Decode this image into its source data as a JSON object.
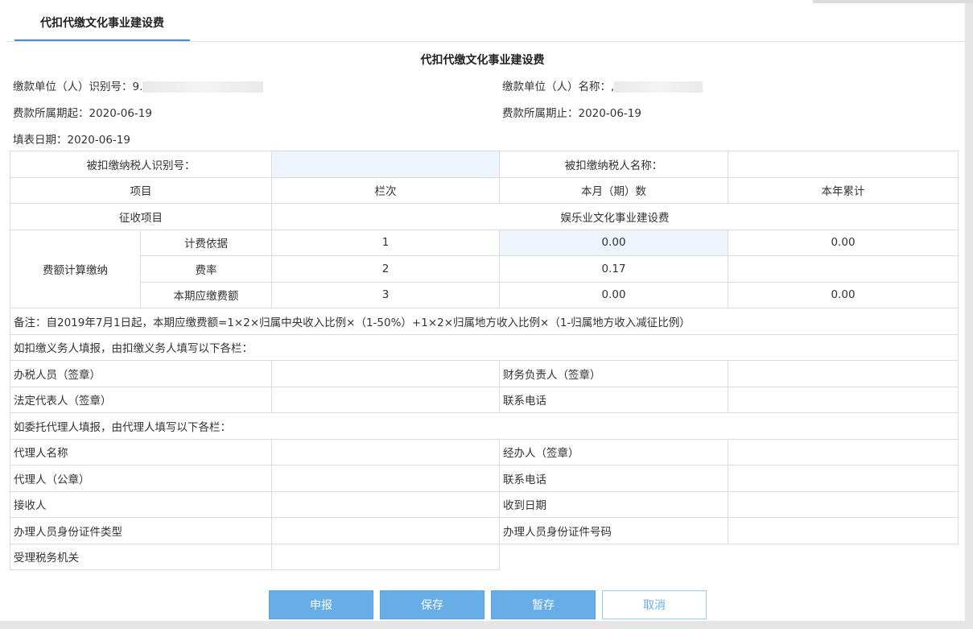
{
  "tab": {
    "label": "代扣代缴文化事业建设费"
  },
  "form_title": "代扣代缴文化事业建设费",
  "header": {
    "payer_id_label": "缴款单位（人）识别号：",
    "payer_id_value": "9.",
    "payer_name_label": "缴款单位（人）名称：",
    "payer_name_value": ",",
    "period_start_label": "费款所属期起：",
    "period_start_value": "2020-06-19",
    "period_end_label": "费款所属期止：",
    "period_end_value": "2020-06-19",
    "fill_date_label": "填表日期：",
    "fill_date_value": "2020-06-19"
  },
  "table": {
    "withheld_id_label": "被扣缴纳税人识别号：",
    "withheld_name_label": "被扣缴纳税人名称：",
    "col_item": "项目",
    "col_line": "栏次",
    "col_month": "本月（期）数",
    "col_year": "本年累计",
    "levy_item_label": "征收项目",
    "levy_item_value": "娱乐业文化事业建设费",
    "calc_group_label": "费额计算缴纳",
    "rows": [
      {
        "label": "计费依据",
        "line": "1",
        "month": "0.00",
        "year": "0.00"
      },
      {
        "label": "费率",
        "line": "2",
        "month": "0.17",
        "year": ""
      },
      {
        "label": "本期应缴费额",
        "line": "3",
        "month": "0.00",
        "year": "0.00"
      }
    ],
    "note": "备注：自2019年7月1日起，本期应缴费额=1×2×归属中央收入比例×（1-50%）+1×2×归属地方收入比例×（1-归属地方收入减征比例）",
    "withholder_section": "如扣缴义务人填报，由扣缴义务人填写以下各栏：",
    "tax_officer_label": "办税人员（签章）",
    "finance_head_label": "财务负责人（签章）",
    "legal_rep_label": "法定代表人（签章）",
    "phone_label_1": "联系电话",
    "agent_section": "如委托代理人填报，由代理人填写以下各栏：",
    "agent_name_label": "代理人名称",
    "handler_label": "经办人（签章）",
    "agent_seal_label": "代理人（公章）",
    "phone_label_2": "联系电话",
    "receiver_label": "接收人",
    "receive_date_label": "收到日期",
    "id_type_label": "办理人员身份证件类型",
    "id_number_label": "办理人员身份证件号码",
    "tax_authority_label": "受理税务机关"
  },
  "buttons": {
    "submit": "申报",
    "save": "保存",
    "draft": "暂存",
    "cancel": "取消"
  }
}
